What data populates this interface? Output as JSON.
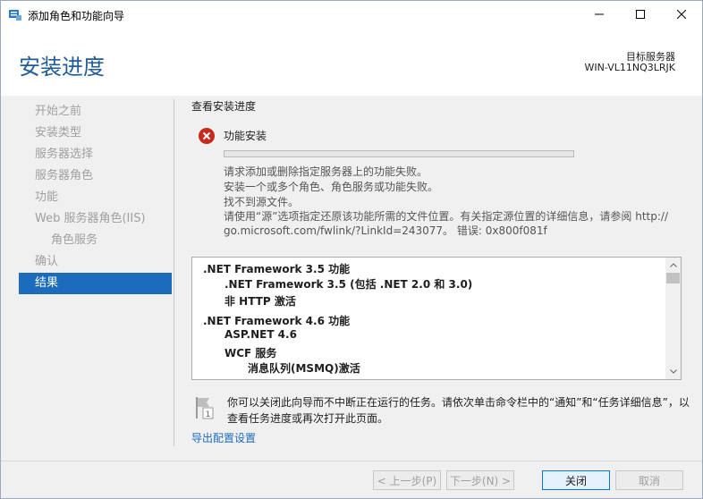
{
  "window": {
    "title": "添加角色和功能向导"
  },
  "header": {
    "page_title": "安装进度",
    "server_label": "目标服务器",
    "server_name": "WIN-VL11NQ3LRJK"
  },
  "nav": {
    "items": [
      {
        "label": "开始之前",
        "state": "disabled"
      },
      {
        "label": "安装类型",
        "state": "disabled"
      },
      {
        "label": "服务器选择",
        "state": "disabled"
      },
      {
        "label": "服务器角色",
        "state": "disabled"
      },
      {
        "label": "功能",
        "state": "disabled"
      },
      {
        "label": "Web 服务器角色(IIS)",
        "state": "disabled"
      },
      {
        "label": "角色服务",
        "state": "disabled",
        "sub": true
      },
      {
        "label": "确认",
        "state": "disabled"
      },
      {
        "label": "结果",
        "state": "active"
      }
    ]
  },
  "main": {
    "section_heading": "查看安装进度",
    "status_title": "功能安装",
    "progress": 0,
    "messages": [
      "请求添加或删除指定服务器上的功能失败。",
      "安装一个或多个角色、角色服务或功能失败。",
      "找不到源文件。",
      "请使用“源”选项指定还原该功能所需的文件位置。有关指定源位置的详细信息，请参阅 http://",
      "go.microsoft.com/fwlink/?LinkId=243077。 错误: 0x800f081f"
    ],
    "results": [
      {
        "text": ".NET Framework 3.5 功能",
        "level": 0
      },
      {
        "text": ".NET Framework 3.5 (包括 .NET 2.0 和 3.0)",
        "level": 1
      },
      {
        "text": "非 HTTP 激活",
        "level": 1
      },
      {
        "text": ".NET Framework 4.6 功能",
        "level": 0
      },
      {
        "text": "ASP.NET 4.6",
        "level": 1
      },
      {
        "text": "WCF 服务",
        "level": 1
      },
      {
        "text": "消息队列(MSMQ)激活",
        "level": 2
      }
    ],
    "note": "你可以关闭此向导而不中断正在运行的任务。请依次单击命令栏中的“通知”和“任务详细信息”，以查看任务进度或再次打开此页面。",
    "export_link": "导出配置设置"
  },
  "footer": {
    "prev_label": "< 上一步(P)",
    "next_label": "下一步(N) >",
    "close_label": "关闭",
    "cancel_label": "取消"
  },
  "colors": {
    "accent": "#1c6bbd",
    "title_blue": "#1f5c99",
    "error_red": "#c42b1c"
  }
}
